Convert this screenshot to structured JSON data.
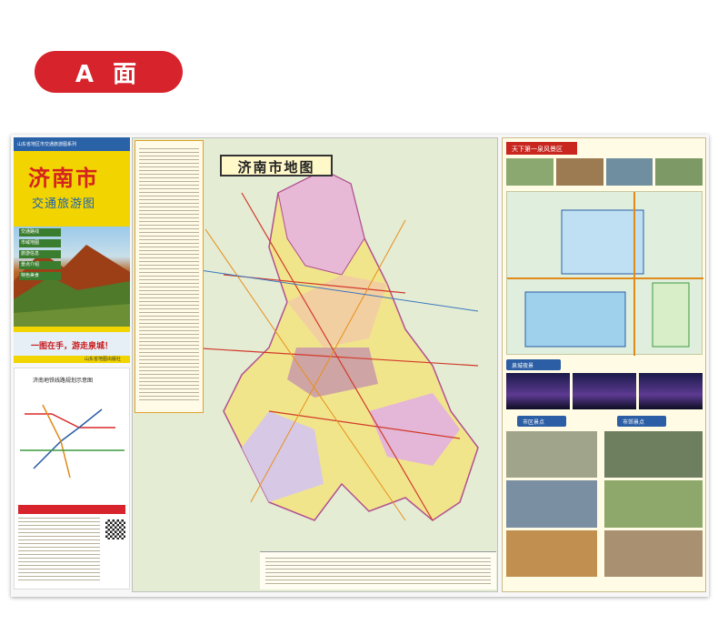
{
  "badge": {
    "label": "A 面"
  },
  "cover": {
    "series": "山东省地区市交通旅游图系列",
    "title": "济南市",
    "subtitle": "交通旅游图",
    "tags": [
      "交通路线",
      "市域地图",
      "旅游信息",
      "景点介绍",
      "特色美食"
    ],
    "slogan": "一图在手，游走泉城！",
    "publisher": "山东省地图出版社"
  },
  "subway": {
    "heading": "济南地铁线路规划示意图"
  },
  "map": {
    "title": "济南市地图"
  },
  "scenic": {
    "header": "天下第一泉风景区",
    "mid_header": "泉城夜景",
    "sec1": "市区景点",
    "sec2": "市郊景点"
  },
  "colors": {
    "badge": "#d7232b",
    "accent_blue": "#2b5ea5",
    "cover_yellow": "#f2d400"
  }
}
